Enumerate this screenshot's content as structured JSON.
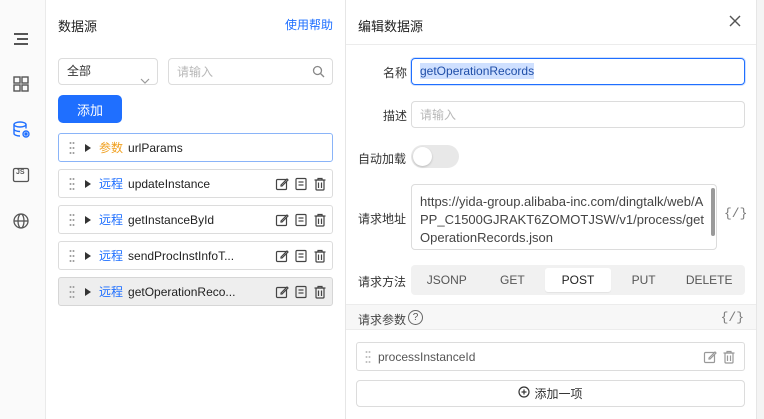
{
  "rail": {
    "icons": [
      "outline-icon",
      "components-icon",
      "datasource-icon",
      "js-icon",
      "globe-icon"
    ],
    "js_label": "JS"
  },
  "datasource": {
    "title": "数据源",
    "help_link": "使用帮助",
    "filter_value": "全部",
    "search_placeholder": "请输入",
    "add_button": "添加",
    "items": [
      {
        "tag": "参数",
        "name": "urlParams"
      },
      {
        "tag": "远程",
        "name": "updateInstance"
      },
      {
        "tag": "远程",
        "name": "getInstanceById"
      },
      {
        "tag": "远程",
        "name": "sendProcInstInfoT..."
      },
      {
        "tag": "远程",
        "name": "getOperationReco..."
      }
    ]
  },
  "editor": {
    "title": "编辑数据源",
    "name_label": "名称",
    "name_value": "getOperationRecords",
    "desc_label": "描述",
    "desc_placeholder": "请输入",
    "autoload_label": "自动加载",
    "autoload_on": false,
    "url_label": "请求地址",
    "url_value": "https://yida-group.alibaba-inc.com/dingtalk/web/APP_C1500GJRAKT6ZOMOTJSW/v1/process/getOperationRecords.json",
    "code_button": "{/}",
    "method_label": "请求方法",
    "methods": [
      "JSONP",
      "GET",
      "POST",
      "PUT",
      "DELETE"
    ],
    "selected_method": "POST",
    "params_label": "请求参数",
    "help_mark": "?",
    "params_code_button": "{/}",
    "params": [
      {
        "name": "processInstanceId"
      }
    ],
    "add_item_button": "添加一项"
  },
  "colors": {
    "accent": "#1f6fff",
    "param_tag": "#f0a020",
    "remote_tag": "#1f6fff"
  }
}
